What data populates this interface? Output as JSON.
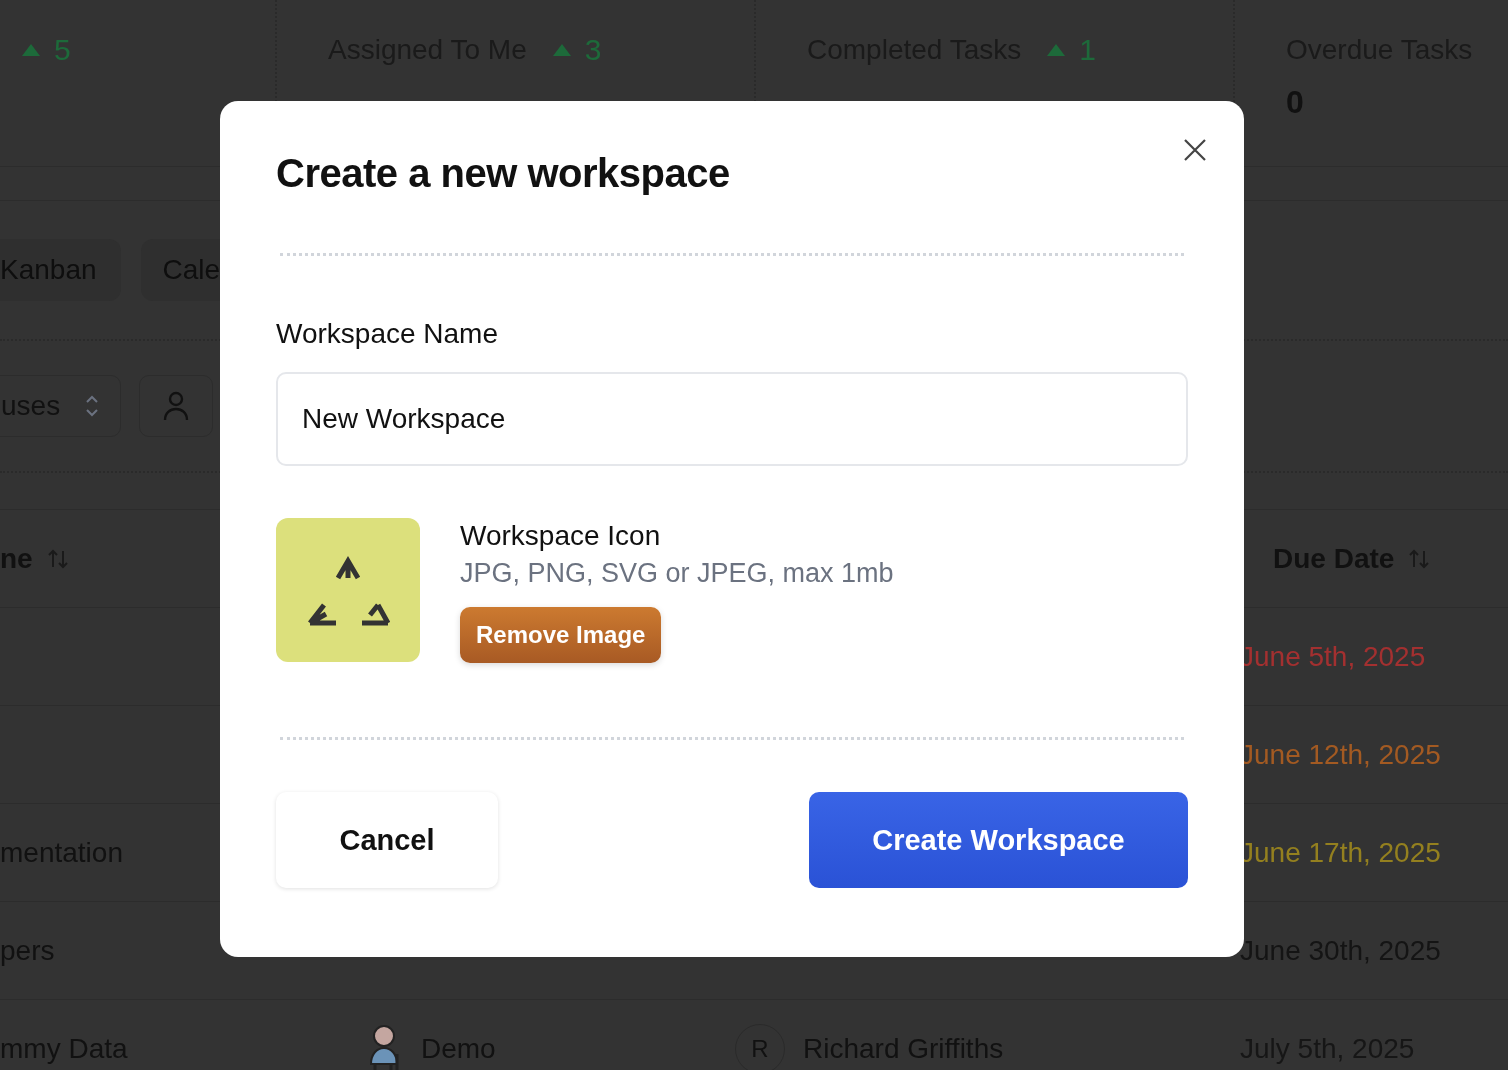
{
  "stats": [
    {
      "trend": "5"
    },
    {
      "label": "Assigned To Me",
      "trend": "3"
    },
    {
      "label": "Completed Tasks",
      "trend": "1"
    },
    {
      "label": "Overdue Tasks",
      "value": "0"
    }
  ],
  "views": [
    {
      "label": "Kanban"
    },
    {
      "label": "Cale"
    }
  ],
  "filters": {
    "status_select": "uses"
  },
  "table": {
    "columns": {
      "column_1": "ne",
      "due_date": "Due Date"
    },
    "rows": [
      {
        "due": "June 5th, 2025",
        "color": "#a33030"
      },
      {
        "due": "June 12th, 2025",
        "color": "#a35a22"
      },
      {
        "name": "mentation",
        "due": "June 17th, 2025",
        "color": "#94801f"
      },
      {
        "name": "pers",
        "due": "June 30th, 2025",
        "color": "#141414"
      },
      {
        "name": "mmy Data",
        "project": "Demo",
        "assignee_initial": "R",
        "assignee": "Richard Griffiths",
        "due": "July 5th, 2025",
        "color": "#161616"
      }
    ]
  },
  "modal": {
    "title": "Create a new workspace",
    "name_label": "Workspace Name",
    "name_value": "New Workspace",
    "icon_label": "Workspace Icon",
    "icon_hint": "JPG, PNG, SVG or JPEG, max 1mb",
    "remove_button": "Remove Image",
    "cancel_button": "Cancel",
    "create_button": "Create Workspace"
  }
}
